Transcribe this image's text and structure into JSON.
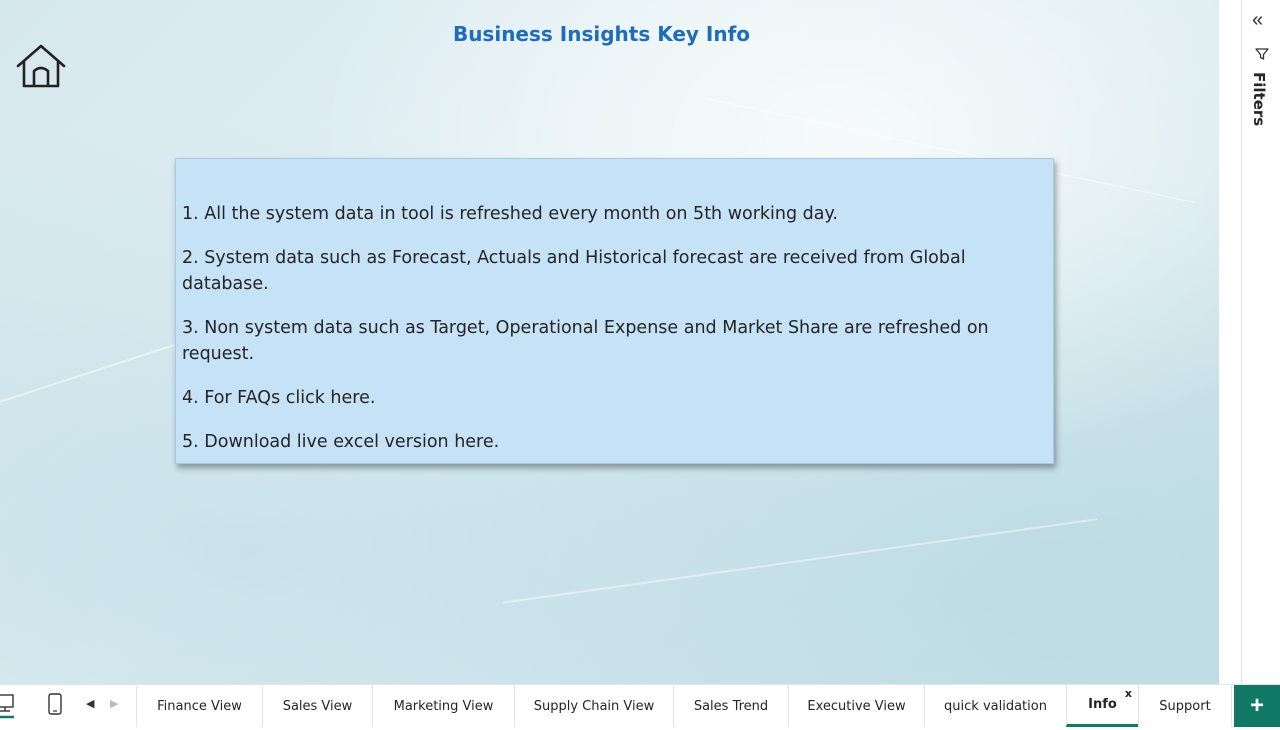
{
  "page": {
    "title": "Business Insights Key Info"
  },
  "home": {
    "icon": "home-icon"
  },
  "info": {
    "items": [
      "1. All the system data in tool is refreshed every month on 5th working day.",
      "2.  System data such as Forecast, Actuals and Historical forecast are received from Global database.",
      "3.  Non system data such as Target, Operational Expense and Market Share are refreshed on request.",
      "4. For FAQs click here.",
      "5. Download live excel version here."
    ]
  },
  "filters": {
    "label": "Filters",
    "collapse_icon": "double-chevron-left-icon",
    "filter_icon": "funnel-icon"
  },
  "tabbar": {
    "desktop_icon": "desktop-icon",
    "mobile_icon": "phone-icon",
    "prev_icon": "triangle-left-icon",
    "next_icon": "triangle-right-icon",
    "tabs": [
      {
        "label": "Finance View"
      },
      {
        "label": "Sales View"
      },
      {
        "label": "Marketing View"
      },
      {
        "label": "Supply Chain View"
      },
      {
        "label": "Sales Trend"
      },
      {
        "label": "Executive View"
      },
      {
        "label": "quick validation"
      },
      {
        "label": "Info",
        "close": "x",
        "active": true
      },
      {
        "label": "Support"
      }
    ],
    "add_label": "+"
  },
  "colors": {
    "title": "#1f6cb8",
    "info_box_bg": "#c5e2f6",
    "accent": "#117865"
  }
}
